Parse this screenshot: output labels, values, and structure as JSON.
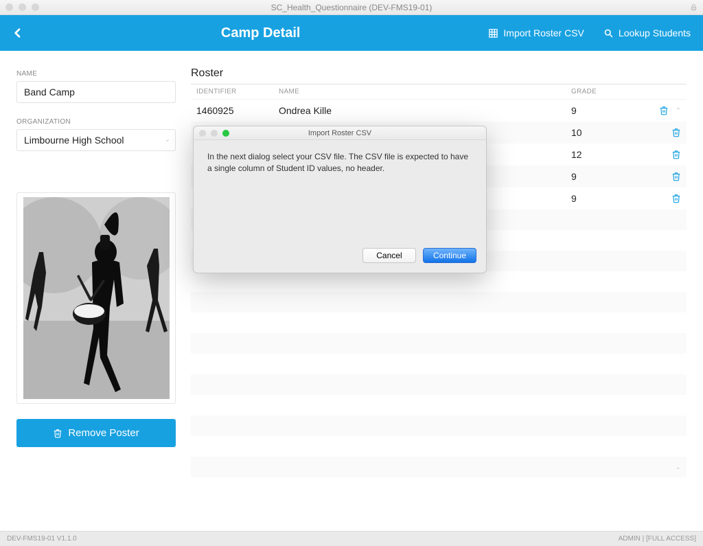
{
  "window": {
    "title": "SC_Health_Questionnaire (DEV-FMS19-01)"
  },
  "header": {
    "title": "Camp Detail",
    "import_label": "Import Roster CSV",
    "lookup_label": "Lookup Students"
  },
  "sidebar": {
    "name_label": "NAME",
    "name_value": "Band Camp",
    "org_label": "ORGANIZATION",
    "org_value": "Limbourne High School",
    "remove_poster_label": "Remove Poster"
  },
  "roster": {
    "title": "Roster",
    "columns": {
      "identifier": "IDENTIFIER",
      "name": "NAME",
      "grade": "GRADE"
    },
    "rows": [
      {
        "identifier": "1460925",
        "name": "Ondrea Kille",
        "grade": "9"
      },
      {
        "identifier": "",
        "name": "",
        "grade": "10"
      },
      {
        "identifier": "",
        "name": "",
        "grade": "12"
      },
      {
        "identifier": "",
        "name": "",
        "grade": "9"
      },
      {
        "identifier": "",
        "name": "",
        "grade": "9"
      }
    ]
  },
  "dialog": {
    "title": "Import Roster CSV",
    "body": "In the next dialog select your CSV file. The CSV file is expected to have a single column of Student ID values, no header.",
    "cancel": "Cancel",
    "continue": "Continue"
  },
  "footer": {
    "left": "DEV-FMS19-01 V1.1.0",
    "right": "ADMIN | [FULL ACCESS]"
  }
}
